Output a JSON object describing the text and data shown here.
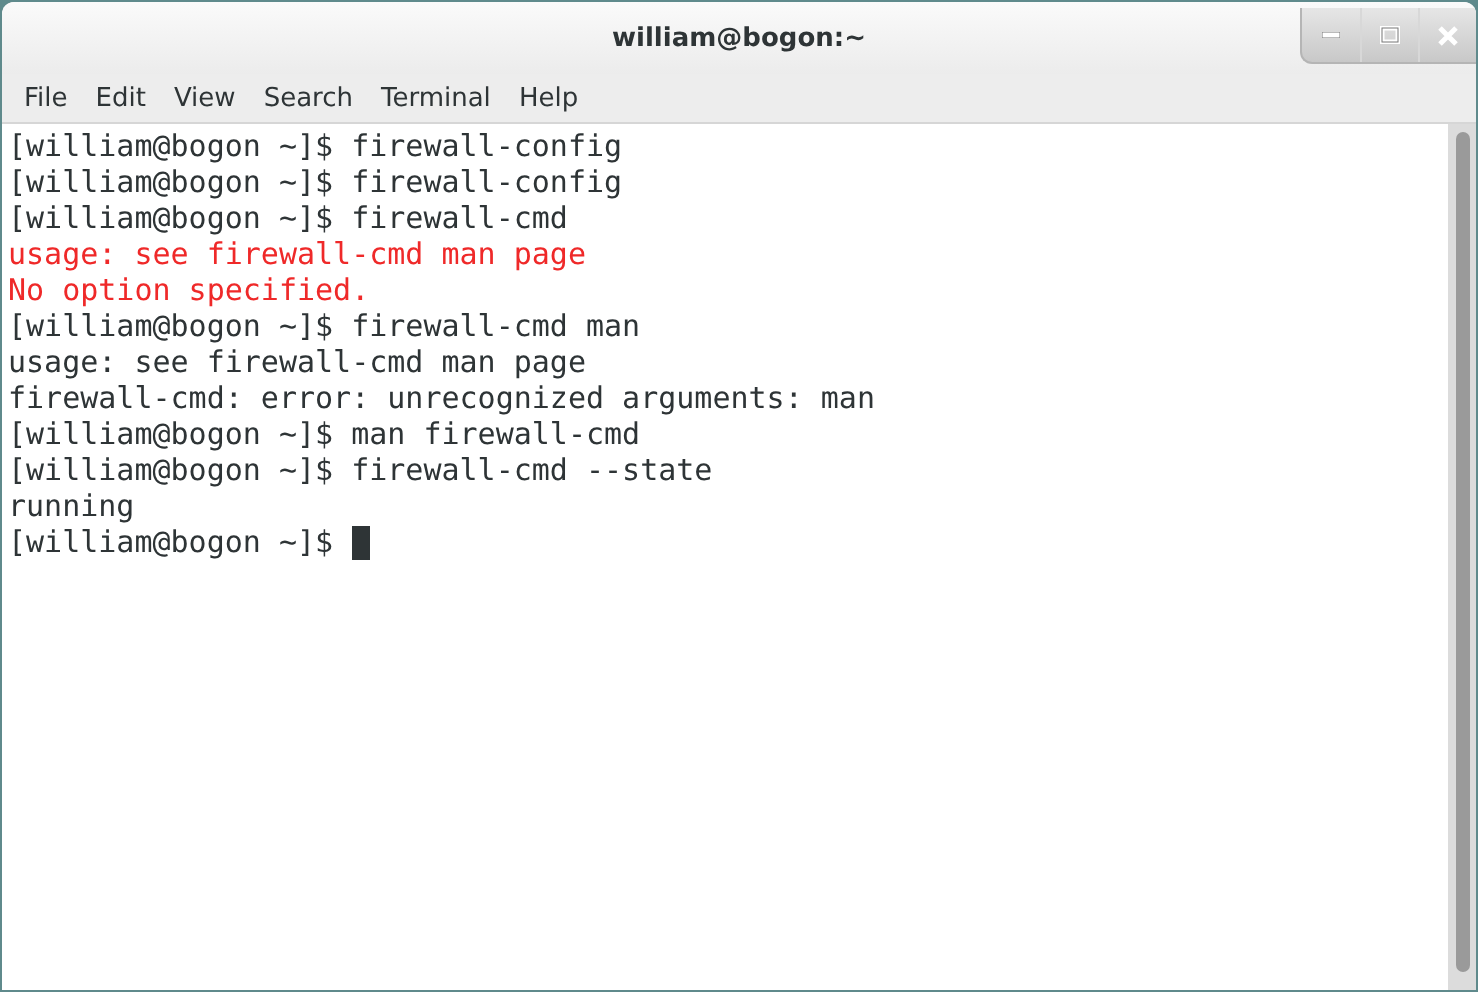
{
  "window": {
    "title": "william@bogon:~"
  },
  "menu": [
    "File",
    "Edit",
    "View",
    "Search",
    "Terminal",
    "Help"
  ],
  "terminal": {
    "lines": [
      {
        "kind": "normal",
        "text": "[william@bogon ~]$ firewall-config"
      },
      {
        "kind": "normal",
        "text": "[william@bogon ~]$ firewall-config"
      },
      {
        "kind": "normal",
        "text": "[william@bogon ~]$ firewall-cmd"
      },
      {
        "kind": "error",
        "text": "usage: see firewall-cmd man page"
      },
      {
        "kind": "error",
        "text": "No option specified."
      },
      {
        "kind": "normal",
        "text": "[william@bogon ~]$ firewall-cmd man"
      },
      {
        "kind": "normal",
        "text": "usage: see firewall-cmd man page"
      },
      {
        "kind": "normal",
        "text": "firewall-cmd: error: unrecognized arguments: man"
      },
      {
        "kind": "normal",
        "text": "[william@bogon ~]$ man firewall-cmd"
      },
      {
        "kind": "normal",
        "text": "[william@bogon ~]$ firewall-cmd --state"
      },
      {
        "kind": "normal",
        "text": "running"
      },
      {
        "kind": "prompt",
        "text": "[william@bogon ~]$ "
      }
    ]
  }
}
